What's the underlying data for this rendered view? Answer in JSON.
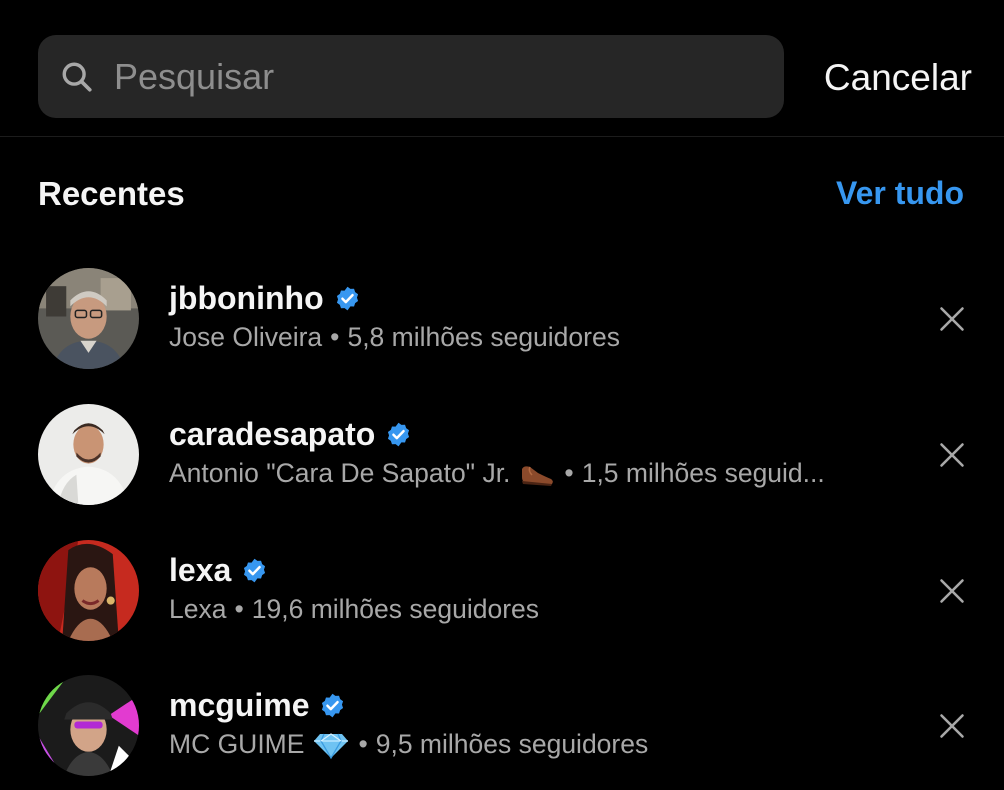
{
  "search": {
    "placeholder": "Pesquisar",
    "cancel_label": "Cancelar"
  },
  "recent": {
    "title": "Recentes",
    "see_all_label": "Ver tudo",
    "items": [
      {
        "username": "jbboninho",
        "verified": true,
        "name": "Jose Oliveira",
        "separator": "•",
        "followers": "5,8 milhões seguidores",
        "emoji": null
      },
      {
        "username": "caradesapato",
        "verified": true,
        "name": "Antonio \"Cara De Sapato\" Jr.",
        "separator": "•",
        "followers": "1,5 milhões seguid...",
        "emoji": "shoe-icon"
      },
      {
        "username": "lexa",
        "verified": true,
        "name": "Lexa",
        "separator": "•",
        "followers": "19,6 milhões seguidores",
        "emoji": null
      },
      {
        "username": "mcguime",
        "verified": true,
        "name": "MC GUIME",
        "separator": "•",
        "followers": "9,5 milhões seguidores",
        "emoji": "diamond-icon"
      }
    ]
  },
  "colors": {
    "background": "#000000",
    "search_bg": "#262626",
    "accent": "#3797f0",
    "secondary_text": "#a8a8a8",
    "verified": "#3797f0"
  }
}
